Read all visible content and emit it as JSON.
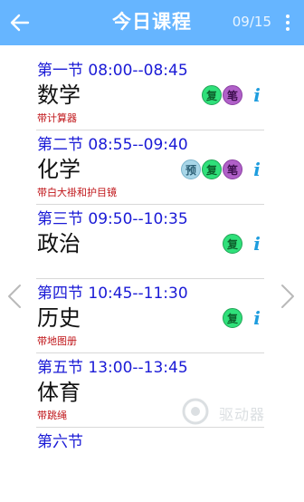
{
  "header": {
    "title": "今日课程",
    "date": "09/15"
  },
  "lessons": [
    {
      "period": "第一节 08:00--08:45",
      "subject": "数学",
      "note": "带计算器",
      "badges": [
        "复",
        "笔"
      ]
    },
    {
      "period": "第二节 08:55--09:40",
      "subject": "化学",
      "note": "带白大褂和护目镜",
      "badges": [
        "预",
        "复",
        "笔"
      ]
    },
    {
      "period": "第三节 09:50--10:35",
      "subject": "政治",
      "note": "",
      "badges": [
        "复"
      ]
    },
    {
      "period": "第四节 10:45--11:30",
      "subject": "历史",
      "note": "带地图册",
      "badges": [
        "复"
      ]
    },
    {
      "period": "第五节 13:00--13:45",
      "subject": "体育",
      "note": "带跳绳",
      "badges": []
    },
    {
      "period": "第六节",
      "subject": "",
      "note": "",
      "badges": []
    }
  ],
  "info_glyph": "i",
  "watermark": "驱动器",
  "colors": {
    "appbar": "#66b5ff",
    "period_text": "#1a1ad6",
    "note_text": "#c0161a",
    "review_badge": "#2fe07a",
    "note_badge": "#b060c8",
    "preview_badge": "#a8d6e8",
    "info_icon": "#1e9dde"
  },
  "icons": {
    "back": "arrow-left-icon",
    "menu": "more-vertical-icon",
    "prev": "chevron-left-icon",
    "next": "chevron-right-icon",
    "info": "info-icon"
  }
}
